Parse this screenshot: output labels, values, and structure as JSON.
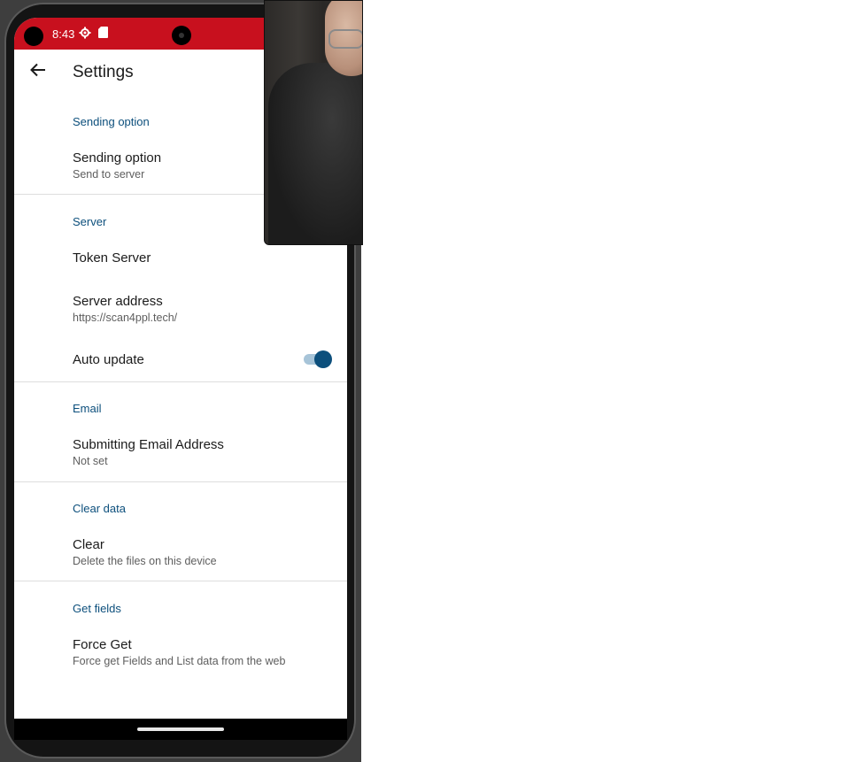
{
  "status_bar": {
    "time": "8:43",
    "icons": [
      "settings-icon",
      "sd-card-icon"
    ],
    "color": "#c8101e"
  },
  "app_bar": {
    "back_icon": "back-arrow-icon",
    "title": "Settings"
  },
  "sections": [
    {
      "header": "Sending option",
      "items": [
        {
          "title": "Sending option",
          "summary": "Send to server"
        }
      ]
    },
    {
      "header": "Server",
      "items": [
        {
          "title": "Token Server",
          "summary": ""
        },
        {
          "title": "Server address",
          "summary": "https://scan4ppl.tech/"
        },
        {
          "title": "Auto update",
          "toggle_on": true
        }
      ]
    },
    {
      "header": "Email",
      "items": [
        {
          "title": "Submitting Email Address",
          "summary": "Not set"
        }
      ]
    },
    {
      "header": "Clear data",
      "items": [
        {
          "title": "Clear",
          "summary": "Delete the files on this device"
        }
      ]
    },
    {
      "header": "Get fields",
      "items": [
        {
          "title": "Force Get",
          "summary": "Force get Fields and List data from the web"
        }
      ]
    }
  ],
  "colors": {
    "accent": "#0c4f7c",
    "toggle_track": "#a7c4d8"
  }
}
